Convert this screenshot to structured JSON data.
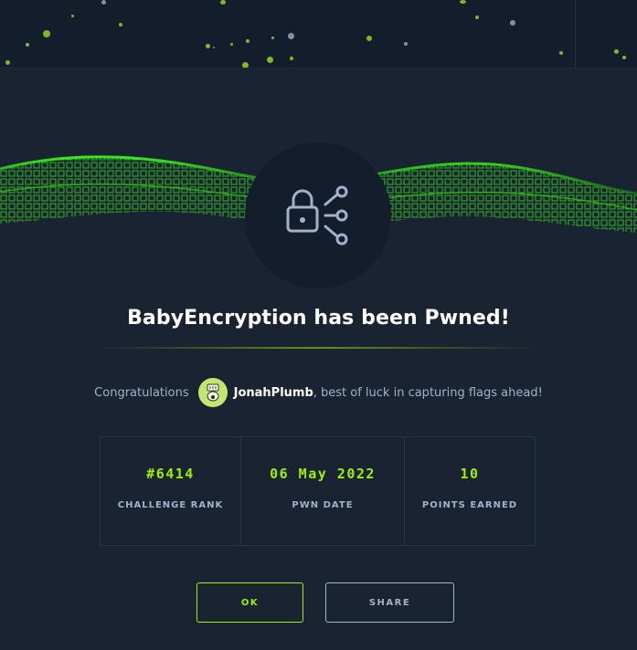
{
  "colors": {
    "background": "#1a2332",
    "panel": "#141d2b",
    "accent": "#9fef00",
    "muted": "#a4b1cd",
    "text": "#ffffff"
  },
  "badge": {
    "icon": "lock-share-icon"
  },
  "title": "BabyEncryption has been Pwned!",
  "congrats": {
    "lead": "Congratulations",
    "username": "JonahPlumb",
    "tail": ", best of luck in capturing flags ahead!"
  },
  "stats": [
    {
      "value": "#6414",
      "label": "CHALLENGE RANK"
    },
    {
      "value": "06 May 2022",
      "label": "PWN DATE"
    },
    {
      "value": "10",
      "label": "POINTS EARNED"
    }
  ],
  "buttons": {
    "ok": "OK",
    "share": "SHARE"
  }
}
